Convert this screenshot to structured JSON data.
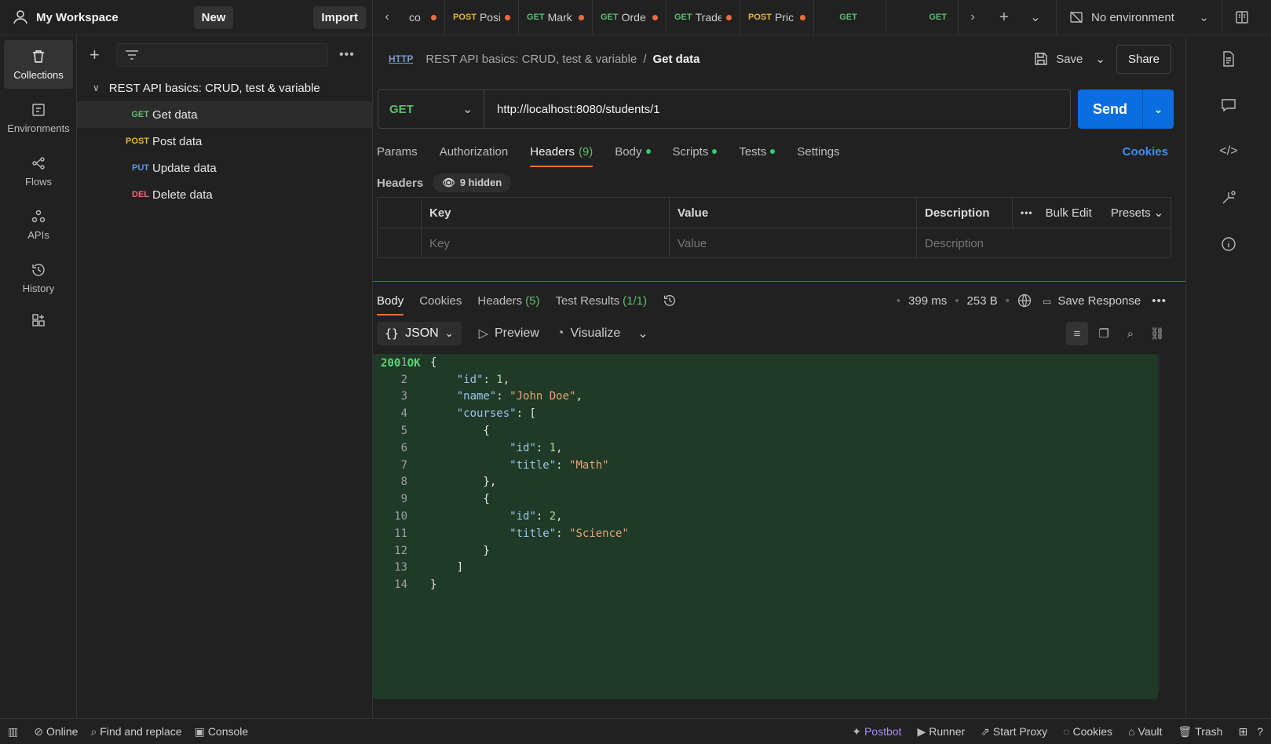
{
  "workspace": {
    "name": "My Workspace",
    "new_label": "New",
    "import_label": "Import"
  },
  "tabs": [
    {
      "method": "",
      "name": "co",
      "dirty": true
    },
    {
      "method": "POST",
      "name": "Posi",
      "dirty": true
    },
    {
      "method": "GET",
      "name": "Mark",
      "dirty": true
    },
    {
      "method": "GET",
      "name": "Orde",
      "dirty": true
    },
    {
      "method": "GET",
      "name": "Trade",
      "dirty": true
    },
    {
      "method": "POST",
      "name": "Pric",
      "dirty": true
    },
    {
      "method": "GET",
      "name": "",
      "dirty": false
    },
    {
      "method": "GET",
      "name": "",
      "dirty": false
    }
  ],
  "environment": {
    "label": "No environment"
  },
  "rail": [
    {
      "id": "collections",
      "label": "Collections",
      "active": true
    },
    {
      "id": "environments",
      "label": "Environments",
      "active": false
    },
    {
      "id": "flows",
      "label": "Flows",
      "active": false
    },
    {
      "id": "apis",
      "label": "APIs",
      "active": false
    },
    {
      "id": "history",
      "label": "History",
      "active": false
    }
  ],
  "sidebar": {
    "collection": "REST API basics: CRUD, test & variable",
    "requests": [
      {
        "method": "GET",
        "name": "Get data",
        "active": true
      },
      {
        "method": "POST",
        "name": "Post data",
        "active": false
      },
      {
        "method": "PUT",
        "name": "Update data",
        "active": false
      },
      {
        "method": "DEL",
        "name": "Delete data",
        "active": false
      }
    ]
  },
  "breadcrumb": {
    "collection": "REST API basics: CRUD, test & variable",
    "sep": "/",
    "request": "Get data"
  },
  "actions": {
    "save": "Save",
    "share": "Share"
  },
  "request": {
    "method": "GET",
    "url": "http://localhost:8080/students/1",
    "send": "Send"
  },
  "req_tabs": {
    "params": "Params",
    "authorization": "Authorization",
    "headers": "Headers",
    "headers_count": "(9)",
    "body": "Body",
    "scripts": "Scripts",
    "tests": "Tests",
    "settings": "Settings",
    "cookies": "Cookies"
  },
  "headers_section": {
    "title": "Headers",
    "hidden": "9 hidden",
    "col_key": "Key",
    "col_value": "Value",
    "col_desc": "Description",
    "bulk_edit": "Bulk Edit",
    "presets": "Presets",
    "ph_key": "Key",
    "ph_value": "Value",
    "ph_desc": "Description"
  },
  "response": {
    "tabs": {
      "body": "Body",
      "cookies": "Cookies",
      "headers": "Headers",
      "headers_count": "(5)",
      "tests": "Test Results",
      "tests_count": "(1/1)"
    },
    "status": "200 OK",
    "time": "399 ms",
    "size": "253 B",
    "save_response": "Save Response",
    "format": "JSON",
    "preview": "Preview",
    "visualize": "Visualize"
  },
  "statusbar": {
    "online": "Online",
    "find": "Find and replace",
    "console": "Console",
    "postbot": "Postbot",
    "runner": "Runner",
    "proxy": "Start Proxy",
    "cookies": "Cookies",
    "vault": "Vault",
    "trash": "Trash"
  },
  "code_lines": [
    "{",
    "    \"id\": 1,",
    "    \"name\": \"John Doe\",",
    "    \"courses\": [",
    "        {",
    "            \"id\": 1,",
    "            \"title\": \"Math\"",
    "        },",
    "        {",
    "            \"id\": 2,",
    "            \"title\": \"Science\"",
    "        }",
    "    ]",
    "}"
  ]
}
